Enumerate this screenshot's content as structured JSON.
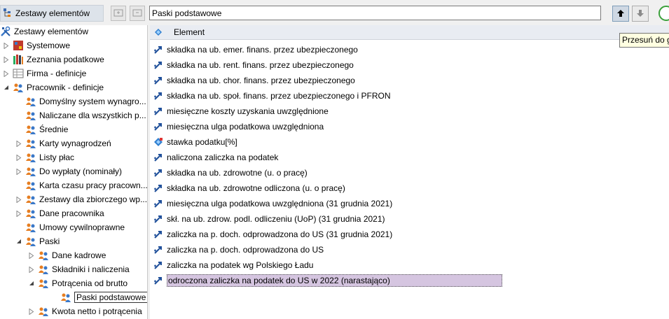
{
  "toolbar": {
    "tab_label": "Zestawy elementów",
    "name_value": "Paski podstawowe",
    "tooltip": "Przesuń do góry"
  },
  "tree": {
    "items": [
      {
        "label": "Zestawy elementów",
        "icon": "tools-icon",
        "expander": "none",
        "level": 0
      },
      {
        "label": "Systemowe",
        "icon": "system-icon",
        "expander": "collapsed",
        "level": 1
      },
      {
        "label": "Zeznania podatkowe",
        "icon": "books-icon",
        "expander": "collapsed",
        "level": 1
      },
      {
        "label": "Firma - definicje",
        "icon": "table-icon",
        "expander": "collapsed",
        "level": 1
      },
      {
        "label": "Pracownik - definicje",
        "icon": "people-icon",
        "expander": "expanded",
        "level": 1
      },
      {
        "label": "Domyślny system wynagro...",
        "icon": "people-icon",
        "expander": "none",
        "level": 2
      },
      {
        "label": "Naliczane dla wszystkich p...",
        "icon": "people-icon",
        "expander": "none",
        "level": 2
      },
      {
        "label": "Średnie",
        "icon": "people-icon",
        "expander": "none",
        "level": 2
      },
      {
        "label": "Karty wynagrodzeń",
        "icon": "people-icon",
        "expander": "collapsed",
        "level": 2
      },
      {
        "label": "Listy płac",
        "icon": "people-icon",
        "expander": "collapsed",
        "level": 2
      },
      {
        "label": "Do wypłaty (nominały)",
        "icon": "people-icon",
        "expander": "collapsed",
        "level": 2
      },
      {
        "label": "Karta czasu pracy pracown...",
        "icon": "people-icon",
        "expander": "none",
        "level": 2
      },
      {
        "label": "Zestawy dla zbiorczego wp...",
        "icon": "people-icon",
        "expander": "collapsed",
        "level": 2
      },
      {
        "label": "Dane pracownika",
        "icon": "people-icon",
        "expander": "collapsed",
        "level": 2
      },
      {
        "label": "Umowy cywilnoprawne",
        "icon": "people-icon",
        "expander": "none",
        "level": 2
      },
      {
        "label": "Paski",
        "icon": "people-icon",
        "expander": "expanded",
        "level": 2
      },
      {
        "label": "Dane kadrowe",
        "icon": "people-icon",
        "expander": "collapsed",
        "level": 3
      },
      {
        "label": "Składniki i naliczenia",
        "icon": "people-icon",
        "expander": "collapsed",
        "level": 3
      },
      {
        "label": "Potrącenia od brutto",
        "icon": "people-icon",
        "expander": "expanded",
        "level": 3
      },
      {
        "label": "Paski podstawowe",
        "icon": "people-icon",
        "expander": "none",
        "level": 4,
        "selected": true
      },
      {
        "label": "Kwota netto i potrącenia",
        "icon": "people-icon",
        "expander": "collapsed",
        "level": 3
      }
    ]
  },
  "grid": {
    "header": "Element",
    "rows": [
      {
        "label": "składka na ub. emer. finans. przez ubezpieczonego",
        "icon": "element-icon"
      },
      {
        "label": "składka na ub. rent. finans. przez ubezpieczonego",
        "icon": "element-icon"
      },
      {
        "label": "składka na ub. chor. finans. przez ubezpieczonego",
        "icon": "element-icon"
      },
      {
        "label": "składka na ub. społ. finans. przez ubezpieczonego i PFRON",
        "icon": "element-icon"
      },
      {
        "label": "miesięczne koszty uzyskania uwzględnione",
        "icon": "element-icon"
      },
      {
        "label": "miesięczna ulga podatkowa uwzględniona",
        "icon": "element-icon"
      },
      {
        "label": "stawka podatku[%]",
        "icon": "parameter-icon"
      },
      {
        "label": "naliczona zaliczka na podatek",
        "icon": "element-icon"
      },
      {
        "label": "składka na ub. zdrowotne (u. o pracę)",
        "icon": "element-icon"
      },
      {
        "label": "składka na ub. zdrowotne odliczona (u. o pracę)",
        "icon": "element-icon"
      },
      {
        "label": "miesięczna ulga podatkowa uwzględniona (31 grudnia 2021)",
        "icon": "element-icon"
      },
      {
        "label": "skł. na ub. zdrow. podl. odliczeniu (UoP) (31 grudnia 2021)",
        "icon": "element-icon"
      },
      {
        "label": "zaliczka na p. doch. odprowadzona do US (31 grudnia 2021)",
        "icon": "element-icon"
      },
      {
        "label": "zaliczka na p. doch. odprowadzona do US",
        "icon": "element-icon"
      },
      {
        "label": "zaliczka na podatek wg Polskiego Ładu",
        "icon": "element-icon"
      },
      {
        "label": "odroczona zaliczka na podatek do US w 2022 (narastająco)",
        "icon": "element-icon",
        "selected": true
      }
    ]
  },
  "colors": {
    "selection": "#d5c5e0",
    "tooltip_bg": "#ffffe1",
    "header_bg": "#e9ecf2"
  }
}
